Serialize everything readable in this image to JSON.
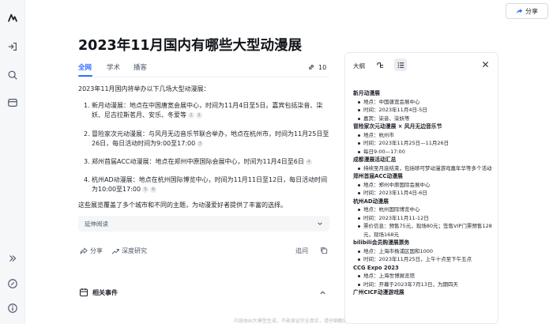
{
  "app": {
    "logo": "logo-icon"
  },
  "rail": {
    "icons": [
      "new-chat-icon",
      "search-icon",
      "library-icon",
      "expand-icon",
      "link-icon",
      "info-icon"
    ]
  },
  "header": {
    "share_label": "分享"
  },
  "article": {
    "title": "2023年11月国内有哪些大型动漫展",
    "tabs": [
      {
        "label": "全网",
        "active": true
      },
      {
        "label": "学术",
        "active": false
      },
      {
        "label": "播客",
        "active": false
      }
    ],
    "ref_count": "10",
    "intro": "2023年11月国内将举办以下几场大型动漫展：",
    "items": [
      {
        "num": "1.",
        "text": "新月动漫展：地点在中国唐宽会展中心，时间为11月4日至5日。嘉宾包括柒音、柒妖、尼古拉斯茗月、安乐、冬爱等",
        "cites": [
          "1",
          "2"
        ]
      },
      {
        "num": "2.",
        "text": "冒险家次元动漫展：与风月无边音乐节联合举办，地点在杭州市，时间为11月25日至26日，每日活动时间为9:00至17:00",
        "cites": [
          "3"
        ]
      },
      {
        "num": "3.",
        "text": "郑州首届ACC动漫展：地点在郑州中原国际会展中心，时间为11月4日至6日",
        "cites": [
          "4"
        ]
      },
      {
        "num": "4.",
        "text": "杭州AD动漫展：地点在杭州国际博览中心，时间为11月11日至12日，每日活动时间为10:00至17:00",
        "cites": [
          "5",
          "6"
        ]
      }
    ],
    "outro": "这些展览覆盖了多个城市和不同的主题，为动漫爱好者提供了丰富的选择。",
    "extend_label": "延伸阅读",
    "actions": {
      "share": "分享",
      "deep_research": "深度研究",
      "followup": "追问"
    },
    "related_label": "相关事件",
    "footnote": "内容由AI大模型生成，不能保证完全真实，请仔细甄别"
  },
  "outline": {
    "title": "大纲",
    "sections": [
      {
        "heading": "新月动漫展",
        "bullets": [
          "地点：中国唐宽会展中心",
          "时间：2023年11月4日-5日",
          "嘉宾：柒音、柒妖等"
        ]
      },
      {
        "heading": "冒险家次元动漫展 × 风月无边音乐节",
        "bullets": [
          "地点：杭州市",
          "时间：2023年11月25日—11月26日",
          "每日9:00—17:00"
        ]
      },
      {
        "heading": "成都漫展活动汇总",
        "bullets": [
          "持续至月底结束，包括哆可梦动漫游戏嘉年华等多个活动"
        ]
      },
      {
        "heading": "郑州首届ACC动漫展",
        "bullets": [
          "地点：郑州中原国际会展中心",
          "时间：2023年11月4日-6日"
        ]
      },
      {
        "heading": "杭州AD动漫展",
        "bullets": [
          "地点：杭州国际博览中心",
          "时间：2023年11月11-12日",
          "票价信息：预售75元，现场80元；签售VIP门票预售128元，现场168元"
        ]
      },
      {
        "heading": "bilibili会员购漫展票务",
        "bullets": [
          "地点：上海市杨浦区国和1000",
          "时间：2023年11月25日，上午十点至下午五点"
        ]
      },
      {
        "heading": "CCG Expo 2023",
        "bullets": [
          "地点：上海世博展览馆",
          "时间：开幕于2023年7月13日，为期四天"
        ]
      },
      {
        "heading": "广州CICF动漫游戏展",
        "bullets": []
      }
    ]
  }
}
